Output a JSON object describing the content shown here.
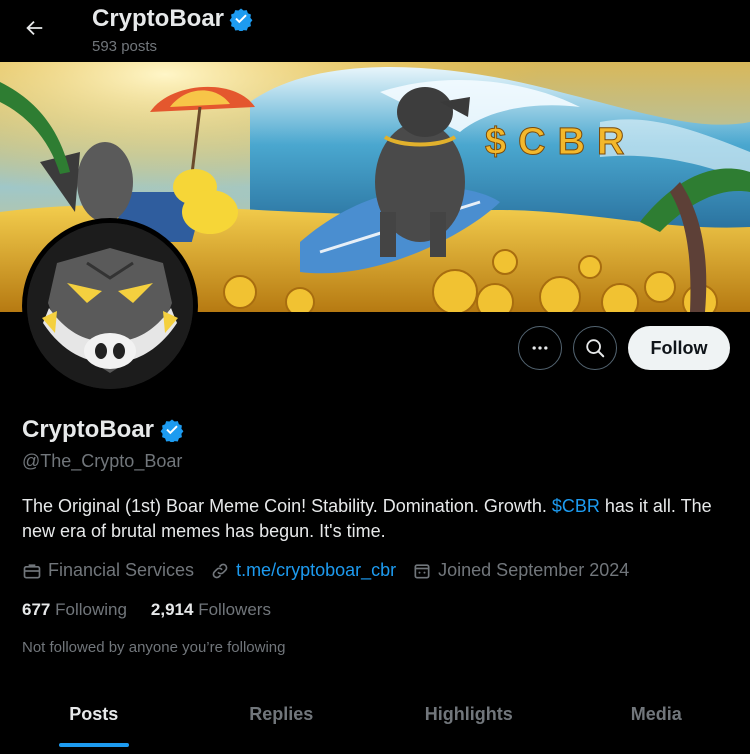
{
  "header": {
    "name": "CryptoBoar",
    "posts_count": "593 posts",
    "back_icon": "arrow-left-icon",
    "verified_icon": "verified-badge-icon"
  },
  "banner": {
    "ticker_text": "$CBR"
  },
  "actions": {
    "more_icon": "more-horizontal-icon",
    "search_icon": "search-icon",
    "follow_label": "Follow"
  },
  "profile": {
    "name": "CryptoBoar",
    "handle": "@The_Crypto_Boar",
    "bio_part1": "The Original (1st) Boar Meme Coin! Stability. Domination. Growth. ",
    "bio_link": "$CBR",
    "bio_part2": " has it all. The new era of brutal memes has begun. It's time.",
    "category": "Financial Services",
    "website": "t.me/cryptoboar_cbr",
    "joined": "Joined September 2024"
  },
  "stats": {
    "following_count": "677",
    "following_label": "Following",
    "followers_count": "2,914",
    "followers_label": "Followers"
  },
  "not_followed_text": "Not followed by anyone you’re following",
  "tabs": [
    {
      "label": "Posts",
      "active": true
    },
    {
      "label": "Replies",
      "active": false
    },
    {
      "label": "Highlights",
      "active": false
    },
    {
      "label": "Media",
      "active": false
    }
  ],
  "colors": {
    "background": "#000000",
    "accent": "#1d9bf0",
    "text_primary": "#e7e9ea",
    "text_secondary": "#71767b",
    "follow_button_bg": "#eff3f4"
  }
}
